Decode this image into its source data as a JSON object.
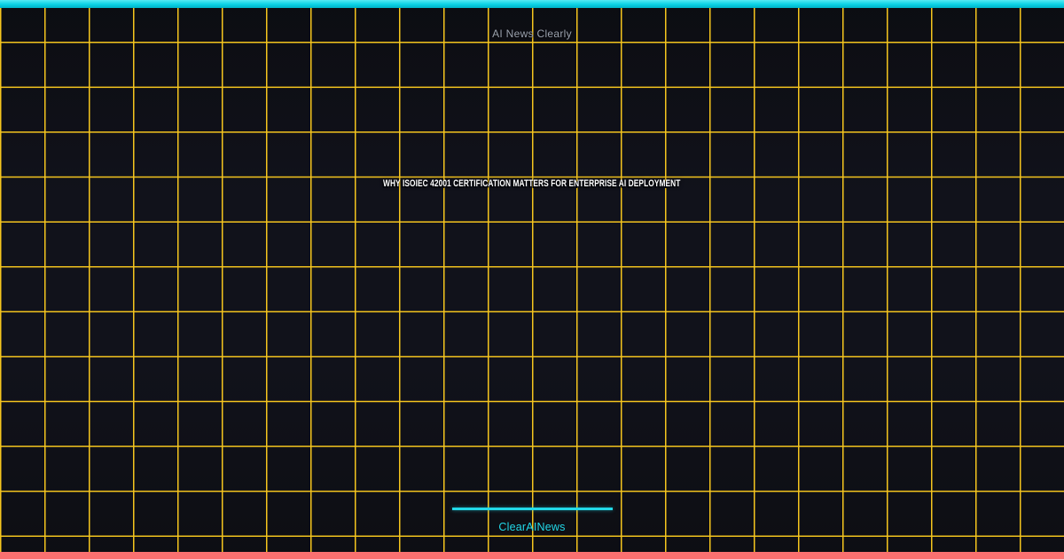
{
  "header": {
    "brand": "AI News Clearly"
  },
  "article": {
    "title": "WHY ISOIEC 42001 CERTIFICATION MATTERS FOR ENTERPRISE AI DEPLOYMENT"
  },
  "footer": {
    "brand": "ClearAINews"
  },
  "colors": {
    "background": "#0f1017",
    "grid_line": "#f5c51e",
    "top_bar_start": "#55eaf4",
    "top_bar_mid": "#0ad2e4",
    "top_bar_end": "#00b3c8",
    "bottom_bar": "#fb7070",
    "header_text": "#9aa1ad",
    "title_text": "#ffffff",
    "accent_cyan": "#22d8e8"
  }
}
